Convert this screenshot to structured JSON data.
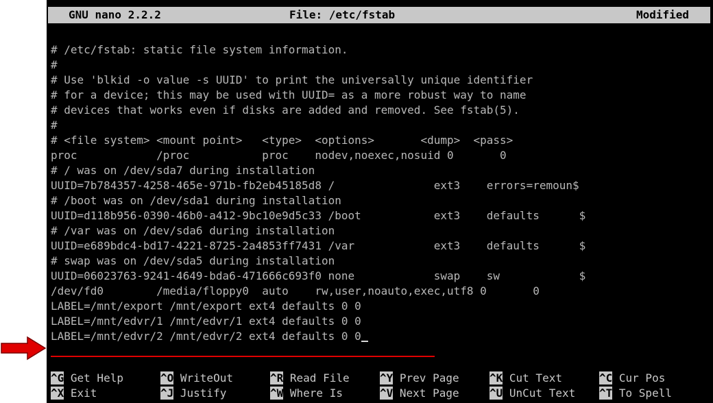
{
  "titlebar": {
    "app": "GNU nano 2.2.2",
    "file": "File: /etc/fstab",
    "status": "Modified"
  },
  "lines": [
    "# /etc/fstab: static file system information.",
    "#",
    "# Use 'blkid -o value -s UUID' to print the universally unique identifier",
    "# for a device; this may be used with UUID= as a more robust way to name",
    "# devices that works even if disks are added and removed. See fstab(5).",
    "#",
    "# <file system> <mount point>   <type>  <options>       <dump>  <pass>",
    "proc            /proc           proc    nodev,noexec,nosuid 0       0",
    "# / was on /dev/sda7 during installation",
    "UUID=7b784357-4258-465e-971b-fb2eb45185d8 /               ext3    errors=remoun$",
    "# /boot was on /dev/sda1 during installation",
    "UUID=d118b956-0390-46b0-a412-9bc10e9d5c33 /boot           ext3    defaults      $",
    "# /var was on /dev/sda6 during installation",
    "UUID=e689bdc4-bd17-4221-8725-2a4853ff7431 /var            ext3    defaults      $",
    "# swap was on /dev/sda5 during installation",
    "UUID=06023763-9241-4649-bda6-471666c693f0 none            swap    sw            $",
    "/dev/fd0        /media/floppy0  auto    rw,user,noauto,exec,utf8 0       0",
    "LABEL=/mnt/export /mnt/export ext4 defaults 0 0",
    "LABEL=/mnt/edvr/1 /mnt/edvr/1 ext4 defaults 0 0",
    "LABEL=/mnt/edvr/2 /mnt/edvr/2 ext4 defaults 0 0"
  ],
  "shortcuts": {
    "row1": [
      {
        "key": "^G",
        "label": "Get Help"
      },
      {
        "key": "^O",
        "label": "WriteOut"
      },
      {
        "key": "^R",
        "label": "Read File"
      },
      {
        "key": "^Y",
        "label": "Prev Page"
      },
      {
        "key": "^K",
        "label": "Cut Text"
      },
      {
        "key": "^C",
        "label": "Cur Pos"
      }
    ],
    "row2": [
      {
        "key": "^X",
        "label": "Exit"
      },
      {
        "key": "^J",
        "label": "Justify"
      },
      {
        "key": "^W",
        "label": "Where Is"
      },
      {
        "key": "^V",
        "label": "Next Page"
      },
      {
        "key": "^U",
        "label": "UnCut Text"
      },
      {
        "key": "^T",
        "label": "To Spell"
      }
    ]
  },
  "colors": {
    "annotation": "#e00000",
    "terminal_bg": "#000000",
    "highlight_bg": "#c8c8c8"
  },
  "icons": {
    "annotation_arrow": "red-arrow-icon"
  }
}
